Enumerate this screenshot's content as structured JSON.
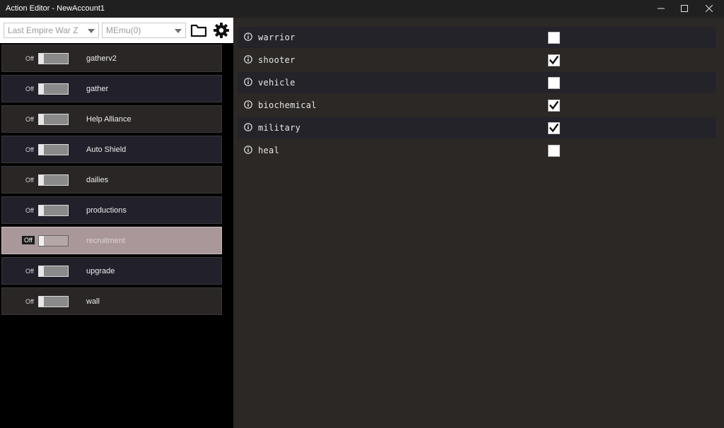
{
  "window": {
    "title": "Action Editor - NewAccount1"
  },
  "toolbar": {
    "game_select": "Last Empire War Z",
    "emulator_select": "MEmu(0)",
    "open_icon": "folder-icon",
    "settings_icon": "gear-icon"
  },
  "actions": [
    {
      "state": "Off",
      "label": "gatherv2"
    },
    {
      "state": "Off",
      "label": "gather"
    },
    {
      "state": "Off",
      "label": "Help Alliance"
    },
    {
      "state": "Off",
      "label": "Auto Shield"
    },
    {
      "state": "Off",
      "label": "dailies"
    },
    {
      "state": "Off",
      "label": "productions"
    },
    {
      "state": "Off",
      "label": "recruitment"
    },
    {
      "state": "Off",
      "label": "upgrade"
    },
    {
      "state": "Off",
      "label": "wall"
    }
  ],
  "selected_action": "recruitment",
  "properties": [
    {
      "label": "warrior",
      "checked": false
    },
    {
      "label": "shooter",
      "checked": true
    },
    {
      "label": "vehicle",
      "checked": false
    },
    {
      "label": "biochemical",
      "checked": true
    },
    {
      "label": "military",
      "checked": true
    },
    {
      "label": "heal",
      "checked": false
    }
  ],
  "colors": {
    "background": "#2b2825",
    "selected_row": "#a9979a",
    "titlebar": "#202020"
  }
}
